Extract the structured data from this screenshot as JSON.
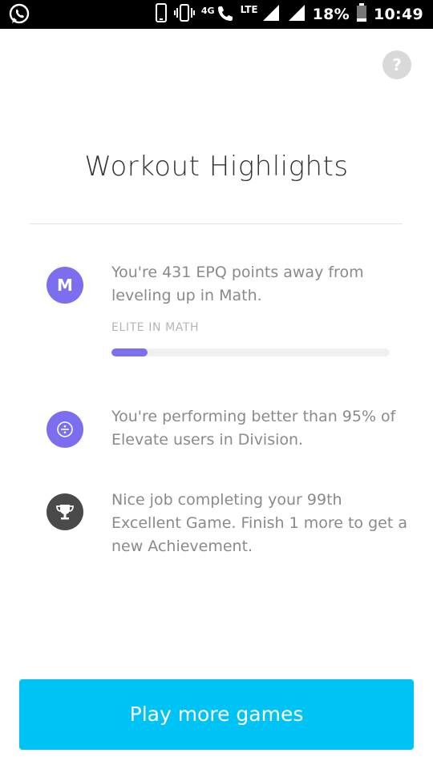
{
  "status_bar": {
    "network_small": "4G",
    "network_type": "LTE",
    "battery": "18%",
    "time": "10:49",
    "icons": [
      "whatsapp-icon",
      "phone-icon",
      "vibrate-icon",
      "call-icon",
      "signal-icon",
      "signal-icon",
      "battery-icon"
    ]
  },
  "header": {
    "help_label": "?",
    "title": "Workout Highlights"
  },
  "highlights": [
    {
      "icon_letter": "M",
      "icon_color": "#7b6ff0",
      "text": "You're 431 EPQ points away from leveling up in Math.",
      "progress_label": "ELITE IN MATH",
      "progress": 0.13
    },
    {
      "icon": "division-icon",
      "icon_color": "#7b6ff0",
      "text": "You're performing better than 95% of Elevate users in Division."
    },
    {
      "icon": "trophy-icon",
      "icon_color": "#4a4a4a",
      "text": "Nice job completing your 99th Excellent Game. Finish 1 more to get a new Achievement."
    }
  ],
  "cta": {
    "label": "Play more games",
    "color": "#00c3f5"
  }
}
